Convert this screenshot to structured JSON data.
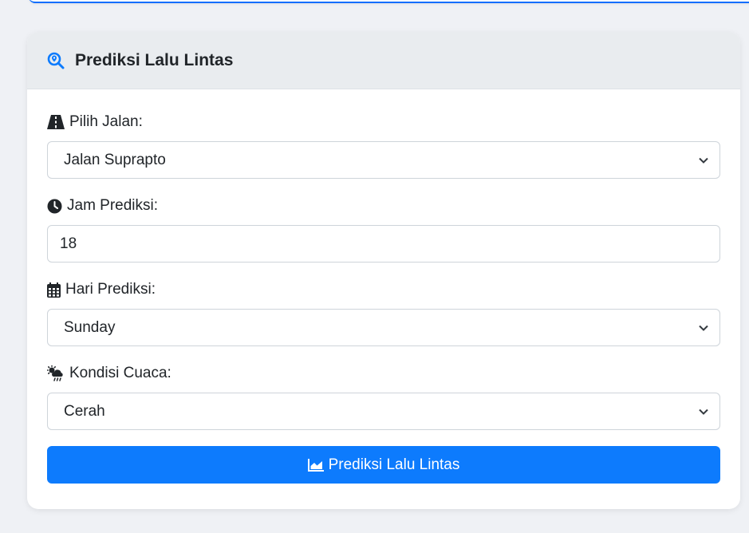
{
  "card": {
    "title": "Prediksi Lalu Lintas",
    "title_icon": "search-location-icon"
  },
  "form": {
    "road": {
      "label": "Pilih Jalan:",
      "icon": "road-icon",
      "value": "Jalan Suprapto"
    },
    "hour": {
      "label": "Jam Prediksi:",
      "icon": "clock-icon",
      "value": "18"
    },
    "day": {
      "label": "Hari Prediksi:",
      "icon": "calendar-icon",
      "value": "Sunday"
    },
    "weather": {
      "label": "Kondisi Cuaca:",
      "icon": "cloud-sun-rain-icon",
      "value": "Cerah"
    }
  },
  "submit": {
    "label": "Prediksi Lalu Lintas",
    "icon": "chart-area-icon"
  },
  "colors": {
    "primary": "#0d7bfd",
    "header_bg": "#e9ecef",
    "page_bg": "#eff1f5"
  }
}
